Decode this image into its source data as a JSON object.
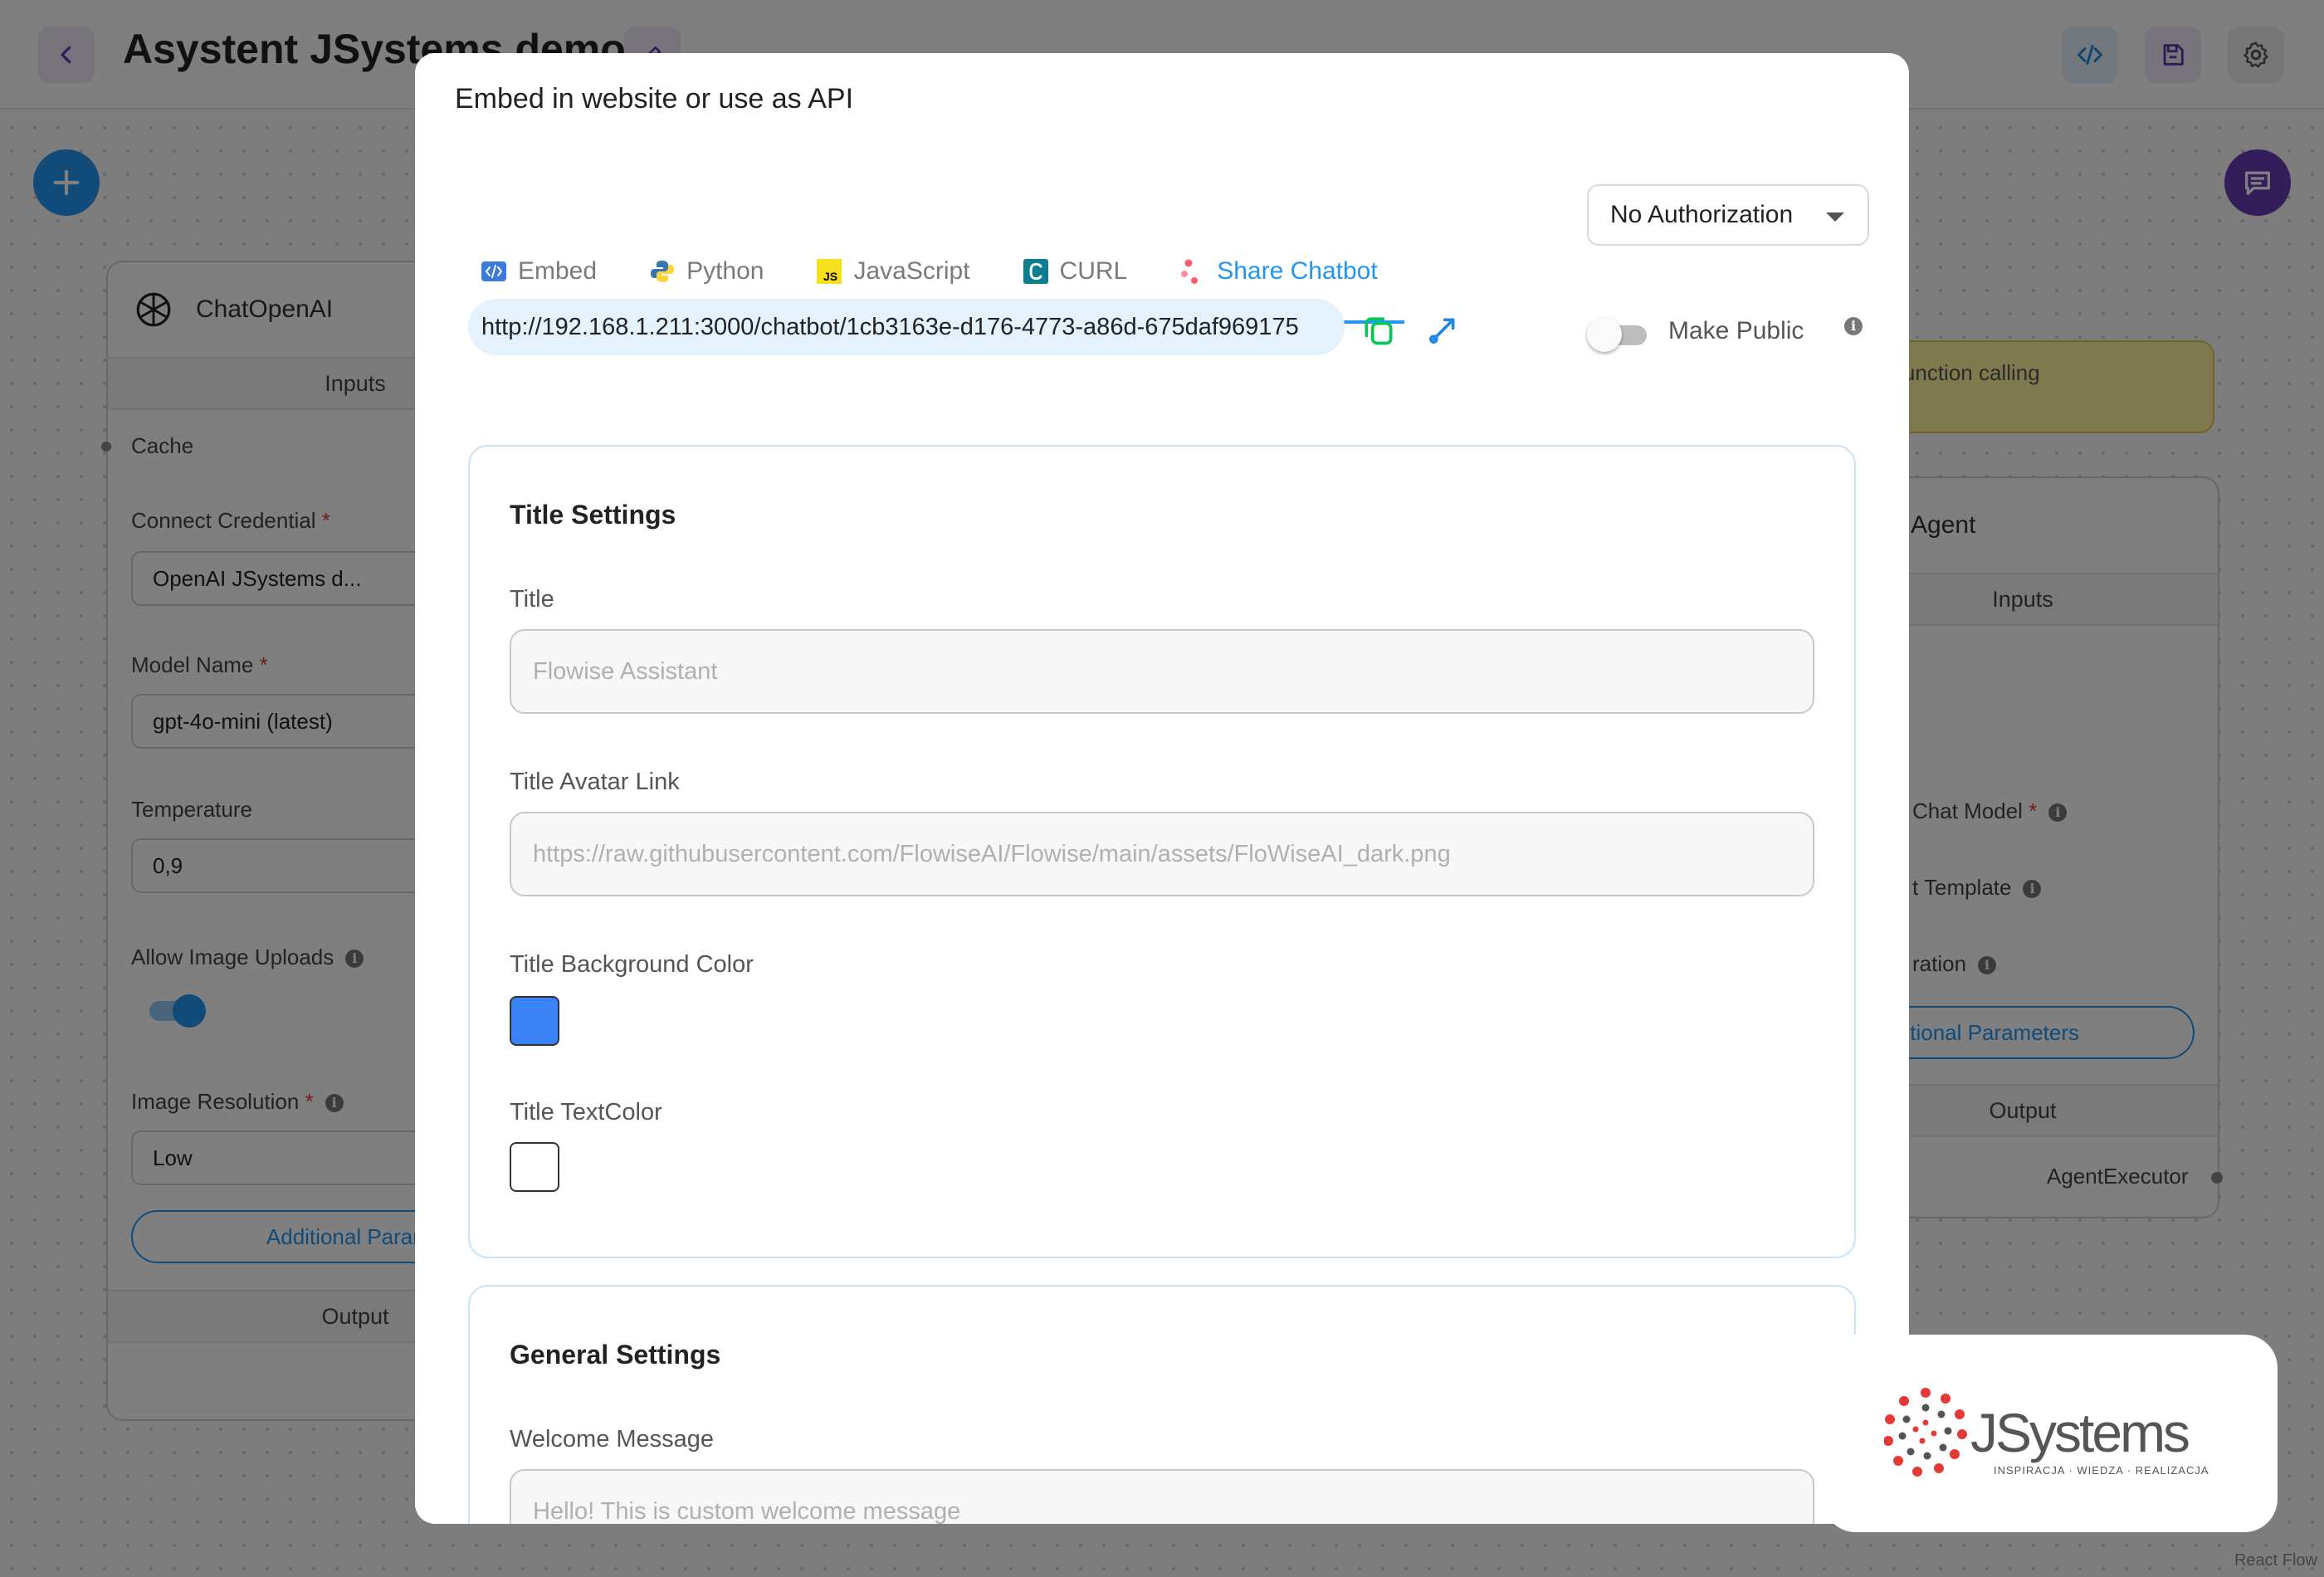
{
  "background": {
    "flow_title": "Asystent JSystems demo",
    "react_flow_attribution": "React Flow",
    "chat_openai_node": {
      "title": "ChatOpenAI",
      "inputs_label": "Inputs",
      "cache_label": "Cache",
      "credential_label": "Connect Credential",
      "credential_value": "OpenAI JSystems d...",
      "model_label": "Model Name",
      "model_value": "gpt-4o-mini (latest)",
      "temperature_label": "Temperature",
      "temperature_value": "0,9",
      "image_uploads_label": "Allow Image Uploads",
      "image_resolution_label": "Image Resolution",
      "image_resolution_value": "Low",
      "additional_params_label": "Additional Paramete",
      "output_label": "Output"
    },
    "agent_node": {
      "warning_text": "e function calling",
      "title": "Agent",
      "inputs_label": "Inputs",
      "chat_model_label": "Chat Model",
      "prompt_template_label": "t Template",
      "moderation_label": "ration",
      "additional_params_label": "ditional Parameters",
      "output_label": "Output",
      "output_value": "AgentExecutor"
    }
  },
  "modal": {
    "title": "Embed in website or use as API",
    "tabs": [
      {
        "label": "Embed",
        "icon": "embed-code-icon"
      },
      {
        "label": "Python",
        "icon": "python-icon"
      },
      {
        "label": "JavaScript",
        "icon": "javascript-icon"
      },
      {
        "label": "CURL",
        "icon": "curl-icon"
      },
      {
        "label": "Share Chatbot",
        "icon": "share-icon"
      }
    ],
    "active_tab": "Share Chatbot",
    "authorization": "No Authorization",
    "share_url": "http://192.168.1.211:3000/chatbot/1cb3163e-d176-4773-a86d-675daf969175",
    "make_public_label": "Make Public",
    "make_public_on": false,
    "title_settings": {
      "heading": "Title Settings",
      "title_label": "Title",
      "title_placeholder": "Flowise Assistant",
      "avatar_label": "Title Avatar Link",
      "avatar_placeholder": "https://raw.githubusercontent.com/FlowiseAI/Flowise/main/assets/FloWiseAI_dark.png",
      "bg_color_label": "Title Background Color",
      "bg_color": "#3b82f6",
      "text_color_label": "Title TextColor",
      "text_color": "#ffffff"
    },
    "general_settings": {
      "heading": "General Settings",
      "welcome_label": "Welcome Message",
      "welcome_placeholder": "Hello! This is custom welcome message"
    }
  },
  "logo": {
    "brand": "JSystems",
    "tagline": "INSPIRACJA · WIEDZA · REALIZACJA"
  },
  "colors": {
    "accent": "#2196f3",
    "purple": "#673ab7",
    "copy_green": "#00c853"
  }
}
